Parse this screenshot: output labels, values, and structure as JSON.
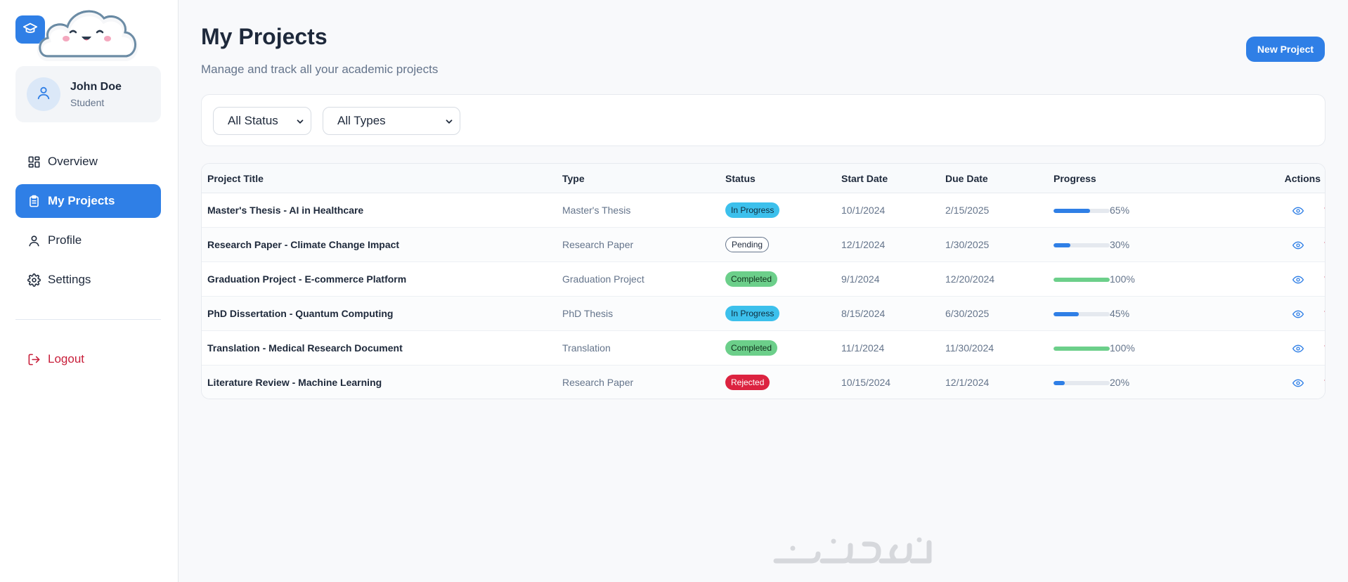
{
  "colors": {
    "accent": "#2f7fe6",
    "danger": "#c81e3a",
    "in_progress_bg": "#3cc0ec",
    "completed_bg": "#6ccf8a",
    "rejected_bg": "#dc2340",
    "progress_blue": "#2f7fe6",
    "progress_green": "#6ccf8a"
  },
  "sidebar": {
    "brand_icon": "graduation-cap-icon",
    "user": {
      "name": "John Doe",
      "role": "Student",
      "icon": "user-icon"
    },
    "items": [
      {
        "label": "Overview",
        "icon": "grid-icon",
        "active": false
      },
      {
        "label": "My Projects",
        "icon": "clipboard-icon",
        "active": true
      },
      {
        "label": "Profile",
        "icon": "user-icon",
        "active": false
      },
      {
        "label": "Settings",
        "icon": "gear-icon",
        "active": false
      }
    ],
    "logout": {
      "label": "Logout",
      "icon": "logout-icon"
    }
  },
  "header": {
    "title": "My Projects",
    "subtitle": "Manage and track all your academic projects",
    "new_button": "New Project"
  },
  "filters": {
    "status": {
      "selected": "All Status"
    },
    "type": {
      "selected": "All Types"
    }
  },
  "table": {
    "columns": [
      "Project Title",
      "Type",
      "Status",
      "Start Date",
      "Due Date",
      "Progress",
      "Actions"
    ],
    "rows": [
      {
        "title": "Master's Thesis - AI in Healthcare",
        "type": "Master's Thesis",
        "status": "In Progress",
        "start": "10/1/2024",
        "due": "2/15/2025",
        "progress": 65,
        "progress_label": "65%"
      },
      {
        "title": "Research Paper - Climate Change Impact",
        "type": "Research Paper",
        "status": "Pending",
        "start": "12/1/2024",
        "due": "1/30/2025",
        "progress": 30,
        "progress_label": "30%"
      },
      {
        "title": "Graduation Project - E-commerce Platform",
        "type": "Graduation Project",
        "status": "Completed",
        "start": "9/1/2024",
        "due": "12/20/2024",
        "progress": 100,
        "progress_label": "100%"
      },
      {
        "title": "PhD Dissertation - Quantum Computing",
        "type": "PhD Thesis",
        "status": "In Progress",
        "start": "8/15/2024",
        "due": "6/30/2025",
        "progress": 45,
        "progress_label": "45%"
      },
      {
        "title": "Translation - Medical Research Document",
        "type": "Translation",
        "status": "Completed",
        "start": "11/1/2024",
        "due": "11/30/2024",
        "progress": 100,
        "progress_label": "100%"
      },
      {
        "title": "Literature Review - Machine Learning",
        "type": "Research Paper",
        "status": "Rejected",
        "start": "10/15/2024",
        "due": "12/1/2024",
        "progress": 20,
        "progress_label": "20%"
      }
    ],
    "actions": {
      "view_icon": "eye-icon",
      "delete_icon": "trash-icon"
    }
  },
  "watermark": {
    "icon": "khamsat-logo-watermark"
  }
}
